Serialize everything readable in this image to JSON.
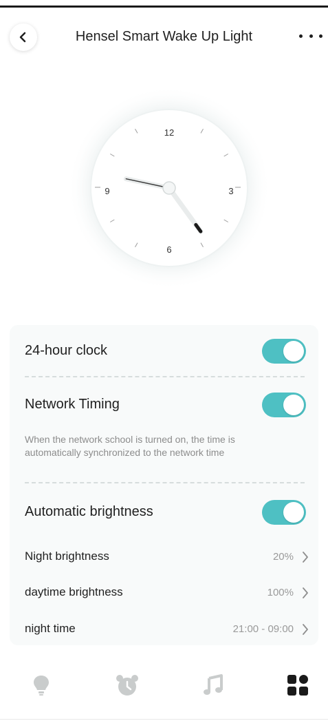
{
  "header": {
    "title": "Hensel Smart Wake Up Light"
  },
  "clock": {
    "numerals": [
      "12",
      "3",
      "6",
      "9"
    ],
    "hour": 9,
    "minute": 24
  },
  "settings": {
    "clock_24h": {
      "label": "24-hour clock",
      "on": true
    },
    "network_timing": {
      "label": "Network Timing",
      "on": true,
      "hint_line1": "When the network school is turned on, the time is",
      "hint_line2": "automatically synchronized to the network time"
    },
    "auto_brightness": {
      "label": "Automatic brightness",
      "on": true
    },
    "night_brightness": {
      "label": "Night brightness",
      "value": "20%"
    },
    "daytime_brightness": {
      "label": "daytime brightness",
      "value": "100%"
    },
    "night_time": {
      "label": "night time",
      "value": "21:00 - 09:00"
    }
  },
  "tabbar": {
    "tabs": [
      {
        "icon": "bulb-icon",
        "active": false
      },
      {
        "icon": "alarm-clock-icon",
        "active": false
      },
      {
        "icon": "music-note-icon",
        "active": false
      },
      {
        "icon": "grid-icon",
        "active": true
      }
    ],
    "active_color": "#1a1a1a",
    "inactive_color": "#c9cccc"
  },
  "colors": {
    "accent": "#4ec0c3"
  }
}
